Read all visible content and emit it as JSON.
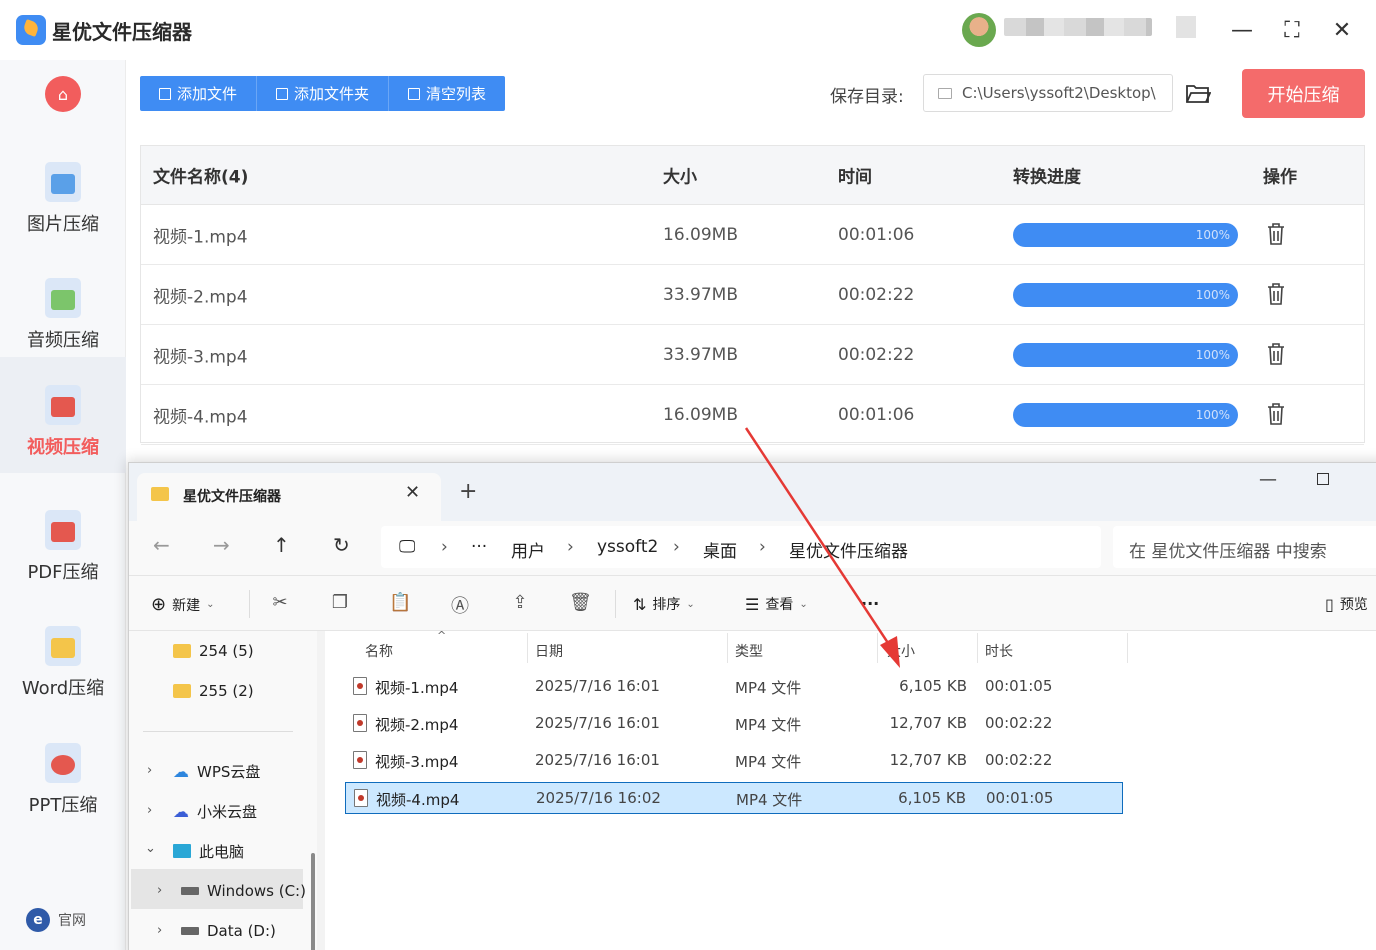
{
  "app": {
    "title": "星优文件压缩器",
    "window_controls": {
      "minimize": "—",
      "maximize": "⛶",
      "close": "✕"
    }
  },
  "sidebar": {
    "items": [
      {
        "label": "图片压缩",
        "icon": "image-icon",
        "color": "#5aa0e8"
      },
      {
        "label": "音频压缩",
        "icon": "music-icon",
        "color": "#7cc56b"
      },
      {
        "label": "视频压缩",
        "icon": "video-icon",
        "color": "#e4584f",
        "active": true
      },
      {
        "label": "PDF压缩",
        "icon": "pdf-icon",
        "color": "#e4584f"
      },
      {
        "label": "Word压缩",
        "icon": "word-icon",
        "color": "#f4c54a"
      },
      {
        "label": "PPT压缩",
        "icon": "ppt-icon",
        "color": "#e4584f"
      }
    ],
    "official_site": "官网"
  },
  "toolbar": {
    "add_file": "添加文件",
    "add_folder": "添加文件夹",
    "clear_list": "清空列表",
    "save_dir_label": "保存目录:",
    "save_dir_value": "C:\\Users\\yssoft2\\Desktop\\",
    "start_button": "开始压缩",
    "accent": "#3f8cf3",
    "start_color": "#f46b6b"
  },
  "file_table": {
    "headers": [
      "文件名称(4)",
      "大小",
      "时间",
      "转换进度",
      "操作"
    ],
    "rows": [
      {
        "name": "视频-1.mp4",
        "size": "16.09MB",
        "time": "00:01:06",
        "progress": "100%"
      },
      {
        "name": "视频-2.mp4",
        "size": "33.97MB",
        "time": "00:02:22",
        "progress": "100%"
      },
      {
        "name": "视频-3.mp4",
        "size": "33.97MB",
        "time": "00:02:22",
        "progress": "100%"
      },
      {
        "name": "视频-4.mp4",
        "size": "16.09MB",
        "time": "00:01:06",
        "progress": "100%"
      }
    ]
  },
  "explorer": {
    "tab_title": "星优文件压缩器",
    "new_tab": "+",
    "breadcrumb": [
      "用户",
      "yssoft2",
      "桌面",
      "星优文件压缩器"
    ],
    "ellipsis": "···",
    "search_placeholder": "在 星优文件压缩器 中搜索",
    "commands": {
      "new": "新建",
      "sort": "排序",
      "view": "查看",
      "more": "···",
      "preview": "预览"
    },
    "nav_tree": {
      "folders": [
        {
          "label": "254 (5)"
        },
        {
          "label": "255 (2)"
        }
      ],
      "locations": [
        {
          "label": "WPS云盘"
        },
        {
          "label": "小米云盘"
        },
        {
          "label": "此电脑"
        },
        {
          "label": "Windows (C:)"
        },
        {
          "label": "Data (D:)"
        }
      ]
    },
    "columns": [
      "名称",
      "日期",
      "类型",
      "大小",
      "时长"
    ],
    "files": [
      {
        "name": "视频-1.mp4",
        "date": "2025/7/16 16:01",
        "type": "MP4 文件",
        "size": "6,105 KB",
        "duration": "00:01:05"
      },
      {
        "name": "视频-2.mp4",
        "date": "2025/7/16 16:01",
        "type": "MP4 文件",
        "size": "12,707 KB",
        "duration": "00:02:22"
      },
      {
        "name": "视频-3.mp4",
        "date": "2025/7/16 16:01",
        "type": "MP4 文件",
        "size": "12,707 KB",
        "duration": "00:02:22"
      },
      {
        "name": "视频-4.mp4",
        "date": "2025/7/16 16:02",
        "type": "MP4 文件",
        "size": "6,105 KB",
        "duration": "00:01:05",
        "selected": true
      }
    ]
  }
}
